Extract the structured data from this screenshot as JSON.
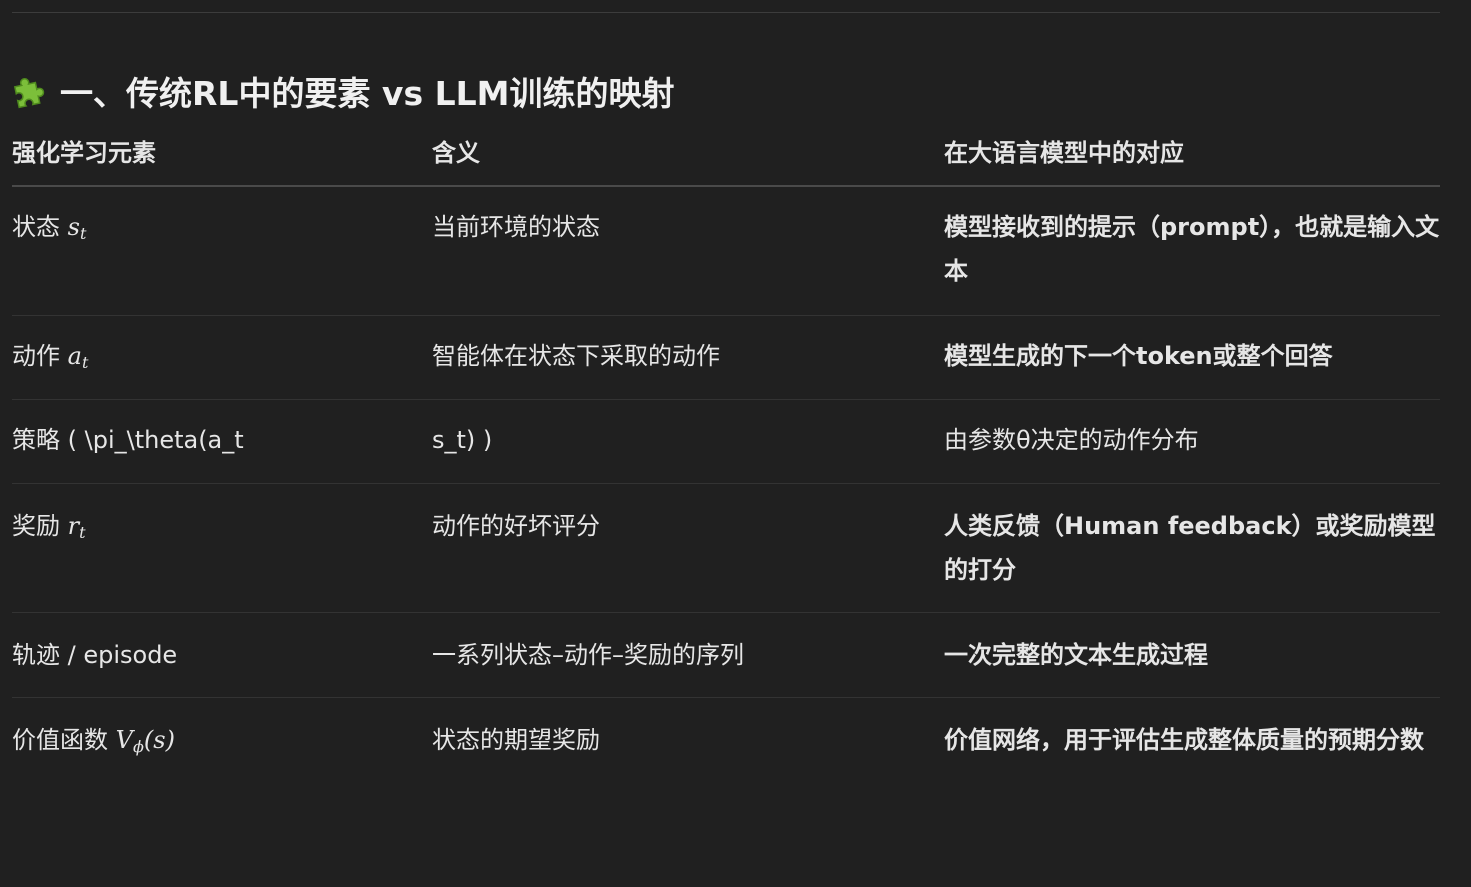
{
  "heading": {
    "icon": "puzzle-piece-icon",
    "text": "一、传统RL中的要素 vs LLM训练的映射"
  },
  "table": {
    "headers": [
      "强化学习元素",
      "含义",
      "在大语言模型中的对应"
    ],
    "rows": [
      {
        "element_label": "状态",
        "element_math_base": "s",
        "element_math_sub": "t",
        "meaning": "当前环境的状态",
        "llm": "模型接收到的提示（prompt），也就是输入文本"
      },
      {
        "element_label": "动作",
        "element_math_base": "a",
        "element_math_sub": "t",
        "meaning": "智能体在状态下采取的动作",
        "llm": "模型生成的下一个token或整个回答"
      },
      {
        "element_text": "策略 ( \\pi_\\theta(a_t",
        "meaning": "s_t) )",
        "llm": "由参数θ决定的动作分布"
      },
      {
        "element_label": "奖励",
        "element_math_base": "r",
        "element_math_sub": "t",
        "meaning": "动作的好坏评分",
        "llm": "人类反馈（Human feedback）或奖励模型的打分"
      },
      {
        "element_text": "轨迹 / episode",
        "meaning": "一系列状态–动作–奖励的序列",
        "llm": "一次完整的文本生成过程"
      },
      {
        "element_label": "价值函数",
        "element_math_base": "V",
        "element_math_sub": "ϕ",
        "element_math_arg": "(s)",
        "meaning": "状态的期望奖励",
        "llm": "价值网络，用于评估生成整体质量的预期分数"
      }
    ]
  }
}
